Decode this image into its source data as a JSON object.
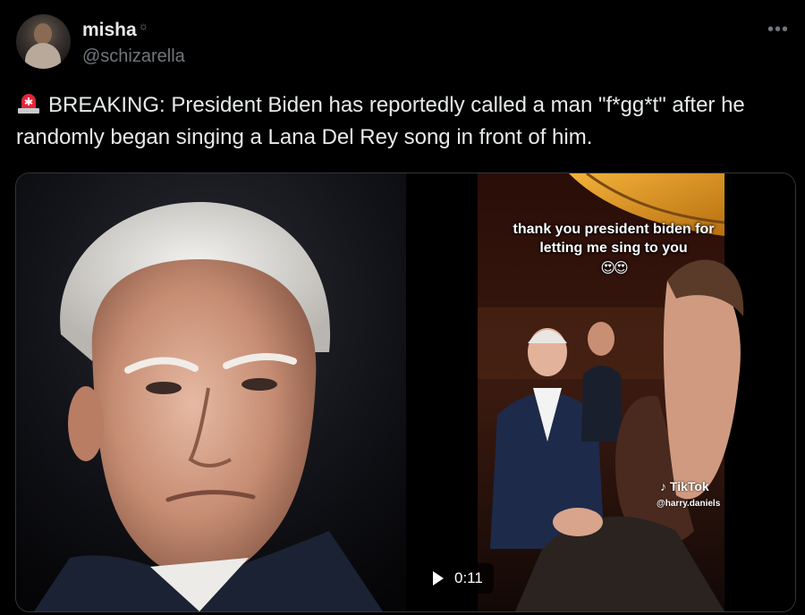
{
  "author": {
    "display_name": "misha",
    "badge": "☼",
    "handle": "@schizarella"
  },
  "menu": {
    "more_label": "•••"
  },
  "tweet": {
    "icon": "rotating-light-icon",
    "text": "BREAKING: President Biden has reportedly called a man \"f*gg*t\" after he randomly began singing a Lana Del Rey song in front of him."
  },
  "video": {
    "caption": "thank you president biden for letting me sing to you",
    "caption_emoji": "😍😍",
    "tiktok_brand": "TikTok",
    "tiktok_handle": "@harry.daniels",
    "duration": "0:11"
  },
  "colors": {
    "background": "#000000",
    "text_primary": "#e7e9ea",
    "text_secondary": "#71767b",
    "border": "#333639"
  }
}
